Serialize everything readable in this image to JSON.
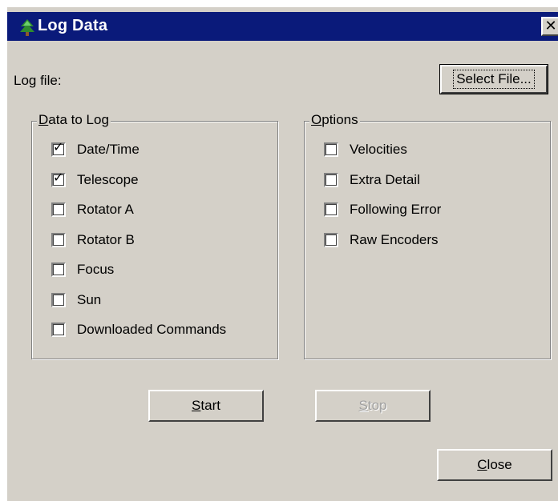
{
  "window": {
    "title": "Log Data",
    "close_glyph": "✕",
    "icon": "tree-icon"
  },
  "log_file": {
    "label": "Log file:",
    "select_button": "Select File...",
    "select_button_mnemonic": "F"
  },
  "data_to_log": {
    "legend_prefix": "D",
    "legend_rest": "ata to Log",
    "items": [
      {
        "label": "Date/Time",
        "checked": true
      },
      {
        "label": "Telescope",
        "checked": true
      },
      {
        "label": "Rotator A",
        "checked": false
      },
      {
        "label": "Rotator B",
        "checked": false
      },
      {
        "label": "Focus",
        "checked": false
      },
      {
        "label": "Sun",
        "checked": false
      },
      {
        "label": "Downloaded Commands",
        "checked": false
      }
    ]
  },
  "options": {
    "legend_prefix": "O",
    "legend_rest": "ptions",
    "items": [
      {
        "label": "Velocities",
        "checked": false
      },
      {
        "label": "Extra Detail",
        "checked": false
      },
      {
        "label": "Following Error",
        "checked": false
      },
      {
        "label": "Raw Encoders",
        "checked": false
      }
    ]
  },
  "buttons": {
    "start_prefix": "S",
    "start_rest": "tart",
    "stop_prefix": "S",
    "stop_rest": "top",
    "close_prefix": "C",
    "close_rest": "lose"
  },
  "check_glyph": "✓"
}
